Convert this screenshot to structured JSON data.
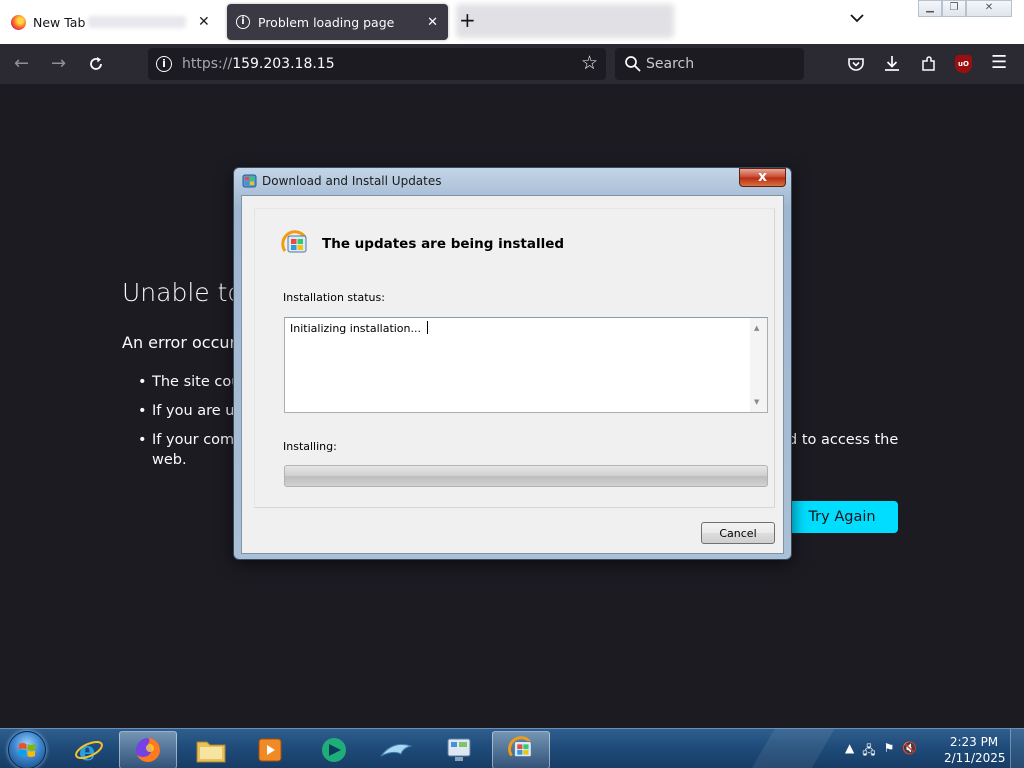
{
  "browser": {
    "tabs": [
      {
        "title": "New Tab",
        "active": false
      },
      {
        "title": "Problem loading page",
        "active": true
      }
    ],
    "url": {
      "scheme": "https://",
      "host": "159.203.18.15"
    },
    "search_placeholder": "Search",
    "icons": [
      "back-icon",
      "forward-icon",
      "reload-icon",
      "bookmark-star-icon",
      "pocket-icon",
      "downloads-icon",
      "extensions-icon",
      "ublock-icon",
      "menu-icon",
      "list-all-tabs-icon"
    ]
  },
  "error_page": {
    "title": "Unable to",
    "subtitle": "An error occur",
    "bullets": [
      {
        "text": "The site cou",
        "tail": ""
      },
      {
        "text": "If you are ur",
        "tail": ""
      },
      {
        "text": "If your comp",
        "tail": "d to access the",
        "continuation": "web."
      }
    ],
    "try_again_label": "Try Again",
    "accent": "#00ddff"
  },
  "dialog": {
    "title": "Download and Install Updates",
    "close_glyph": "x",
    "heading": "The updates are being installed",
    "status_label": "Installation status:",
    "status_text": "Initializing installation...",
    "progress_label": "Installing:",
    "progress_fraction": 0,
    "cancel_label": "Cancel"
  },
  "taskbar": {
    "items": [
      "start-orb",
      "internet-explorer",
      "firefox",
      "windows-explorer",
      "media-player",
      "green-app",
      "dolphin-app",
      "control-panel",
      "windows-update"
    ],
    "active_item": "firefox",
    "clock": {
      "time": "2:23 PM",
      "date": "2/11/2025"
    }
  }
}
